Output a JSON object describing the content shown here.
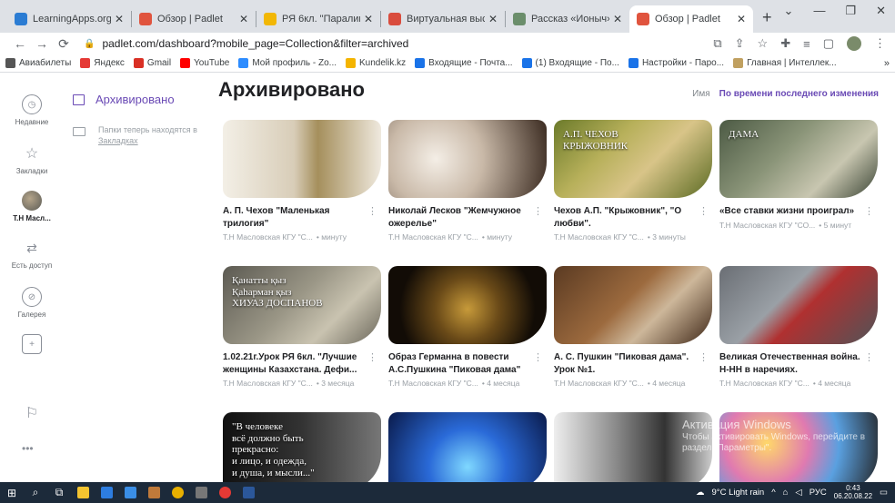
{
  "browser": {
    "tabs": [
      {
        "label": "LearningApps.org - со",
        "color": "#2b7cd3"
      },
      {
        "label": "Обзор | Padlet",
        "color": "#e0543e"
      },
      {
        "label": "РЯ 6кл. \"Паралимпий",
        "color": "#f2b705"
      },
      {
        "label": "Виртуальная выставк",
        "color": "#d94c3d"
      },
      {
        "label": "Рассказ «Ионыч». Ден",
        "color": "#6b8e6b"
      },
      {
        "label": "Обзор | Padlet",
        "color": "#e0543e",
        "active": true
      }
    ],
    "url": "padlet.com/dashboard?mobile_page=Collection&filter=archived",
    "bookmarks": [
      {
        "label": "Авиабилеты",
        "color": "#555"
      },
      {
        "label": "Яндекс",
        "color": "#e53935"
      },
      {
        "label": "Gmail",
        "color": "#d93025"
      },
      {
        "label": "YouTube",
        "color": "#ff0000"
      },
      {
        "label": "Мой профиль - Zo...",
        "color": "#2d8cff"
      },
      {
        "label": "Kundelik.kz",
        "color": "#f4b400"
      },
      {
        "label": "Входящие - Почта...",
        "color": "#1a73e8"
      },
      {
        "label": "(1) Входящие - По...",
        "color": "#1a73e8"
      },
      {
        "label": "Настройки - Паро...",
        "color": "#1a73e8"
      },
      {
        "label": "Главная | Интеллек...",
        "color": "#c0a060"
      }
    ]
  },
  "sidebar": {
    "recent": "Недавние",
    "bookmarks": "Закладки",
    "user": "Т.Н Масл...",
    "shared": "Есть доступ",
    "gallery": "Галерея"
  },
  "panel": {
    "title": "Архивировано",
    "note_text": "Папки теперь находятся в",
    "note_link": "Закладках"
  },
  "main": {
    "title": "Архивировано",
    "sort_name": "Имя",
    "sort_time": "По времени последнего изменения"
  },
  "cards": [
    {
      "title": "А. П. Чехов \"Маленькая трилогия\"",
      "author": "Т.Н Масловская КГУ \"С...",
      "time": "• минуту",
      "bg": "linear-gradient(90deg,#f3efe6 0%,#d8cdb8 45%,#a58f5c 60%,#efe9de 100%)"
    },
    {
      "title": "Николай Лесков \"Жемчужное ожерелье\"",
      "author": "Т.Н Масловская КГУ \"С...",
      "time": "• минуту",
      "bg": "radial-gradient(circle at 30% 50%,#f4eee6 0%,#c9b9a8 40%,#3a2a20 100%)"
    },
    {
      "title": "Чехов А.П. \"Крыжовник\", \"О любви\".",
      "author": "Т.Н Масловская КГУ \"С...",
      "time": "• 3 минуты",
      "bg": "linear-gradient(135deg,#6b7a2a 0%,#b7b05a 35%,#d8c488 60%,#5a6a22 100%)",
      "overlay": "А.П. ЧЕХОВ\nКРЫЖОВНИК"
    },
    {
      "title": "«Все ставки жизни проиграл»",
      "author": "Т.Н Масловская КГУ \"СО...",
      "time": "• 5 минут",
      "bg": "linear-gradient(135deg,#4c5a44 0%,#8a9478 40%,#c8c6b0 70%,#3a4434 100%)",
      "overlay": "ДАМА"
    },
    {
      "title": "1.02.21г.Урок РЯ 6кл. \"Лучшие женщины Казахстана. Дефи...",
      "author": "Т.Н Масловская КГУ \"С...",
      "time": "• 3 месяца",
      "bg": "linear-gradient(135deg,#5c5a52 0%,#9a9686 45%,#c9c3b0 70%,#6a665a 100%)",
      "overlay": "Қанатты қыз\nҚаһарман қыз\nХИУАЗ ДОСПАНОВ"
    },
    {
      "title": "Образ Германна в повести А.С.Пушкина \"Пиковая дама\"",
      "author": "Т.Н Масловская КГУ \"С...",
      "time": "• 4 месяца",
      "bg": "radial-gradient(circle at 50% 55%,#c79a3a 0%,#6a4a18 35%,#120c06 75%)"
    },
    {
      "title": "А. С. Пушкин \"Пиковая дама\". Урок №1.",
      "author": "Т.Н Масловская КГУ \"С...",
      "time": "• 4 месяца",
      "bg": "linear-gradient(135deg,#5a3a22 0%,#9c6a3e 45%,#cdb79a 65%,#3e2616 100%)"
    },
    {
      "title": "Великая Отечественная война. Н-НН в наречиях.",
      "author": "Т.Н Масловская КГУ \"С...",
      "time": "• 4 месяца",
      "bg": "linear-gradient(135deg,#6a6e74 0%,#9aa0a6 40%,#b03030 55%,#505458 100%)"
    },
    {
      "title": "",
      "author": "",
      "time": "",
      "bg": "linear-gradient(90deg,#111 0%,#333 50%,#777 100%)",
      "overlay": "\"В человеке\nвсё должно быть\nпрекрасно:\nи лицо, и одежда,\nи душа, и мысли...\""
    },
    {
      "title": "",
      "author": "",
      "time": "",
      "bg": "radial-gradient(circle at 50% 70%,#7fd8ff 0%,#2a6ad8 40%,#0a1a4a 100%)"
    },
    {
      "title": "",
      "author": "",
      "time": "",
      "bg": "linear-gradient(90deg,#eee 0%,#888 40%,#333 70%,#ccc 100%)"
    },
    {
      "title": "",
      "author": "",
      "time": "",
      "bg": "radial-gradient(circle at 30% 40%,#ffd86a 0%,#e07ab0 35%,#5aa0e0 60%,#222 100%)"
    }
  ],
  "watermark": {
    "line1": "Активация Windows",
    "line2": "Чтобы активировать Windows, перейдите в раздел \"Параметры\"."
  },
  "taskbar": {
    "weather": "9°C  Light rain",
    "lang": "РУС",
    "time": "0:43",
    "date": "06.20.08.22"
  }
}
